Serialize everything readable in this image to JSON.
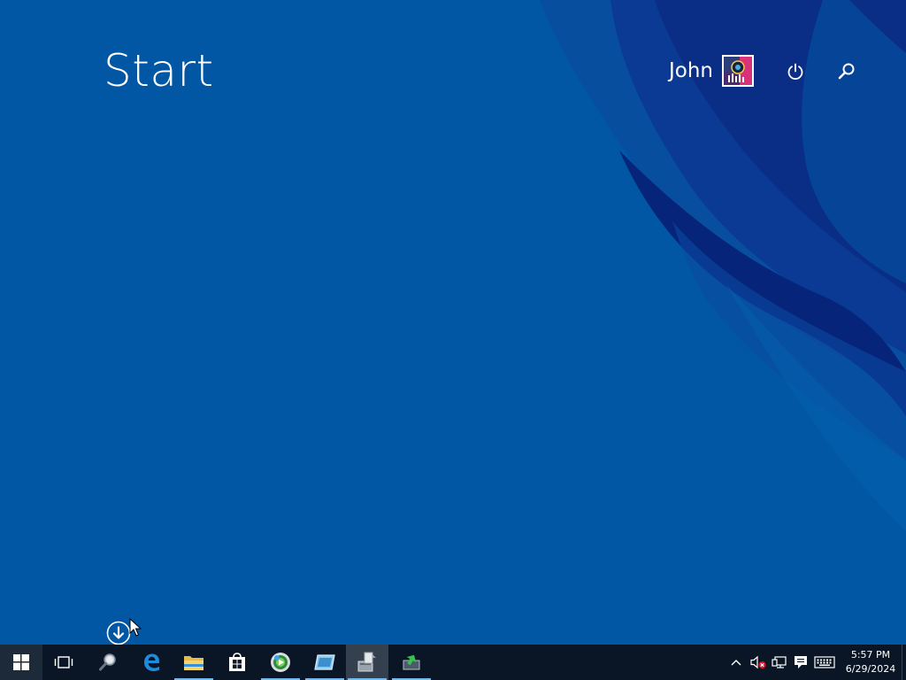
{
  "start_screen": {
    "title": "Start",
    "user_name": "John",
    "icons": {
      "avatar": "user-avatar",
      "power": "power-icon",
      "search": "search-icon",
      "all_apps": "arrow-down-circle-icon"
    }
  },
  "taskbar": {
    "start_icon": "windows-logo-icon",
    "apps": [
      {
        "name": "task-view",
        "icon": "task-view-icon",
        "active": false
      },
      {
        "name": "search",
        "icon": "magnifier-icon",
        "active": false
      },
      {
        "name": "edge",
        "icon": "edge-icon",
        "active": false
      },
      {
        "name": "file-explorer",
        "icon": "folder-icon",
        "active": true
      },
      {
        "name": "store",
        "icon": "store-bag-icon",
        "active": false
      },
      {
        "name": "media-player",
        "icon": "media-player-icon",
        "active": true
      },
      {
        "name": "app-window",
        "icon": "app-window-icon",
        "active": true
      },
      {
        "name": "installer",
        "icon": "installer-icon",
        "active": true
      },
      {
        "name": "tray-app",
        "icon": "green-arrow-tray-icon",
        "active": true
      }
    ],
    "tray": {
      "icons": [
        "chevron-up-icon",
        "volume-muted-icon",
        "network-icon",
        "action-center-icon",
        "keyboard-icon"
      ],
      "time": "5:57 PM",
      "date": "6/29/2024"
    }
  },
  "colors": {
    "background": "#0157a4",
    "wave_dark": "#0a2d86",
    "taskbar": "#0a1626",
    "accent": "#76b9ed"
  }
}
